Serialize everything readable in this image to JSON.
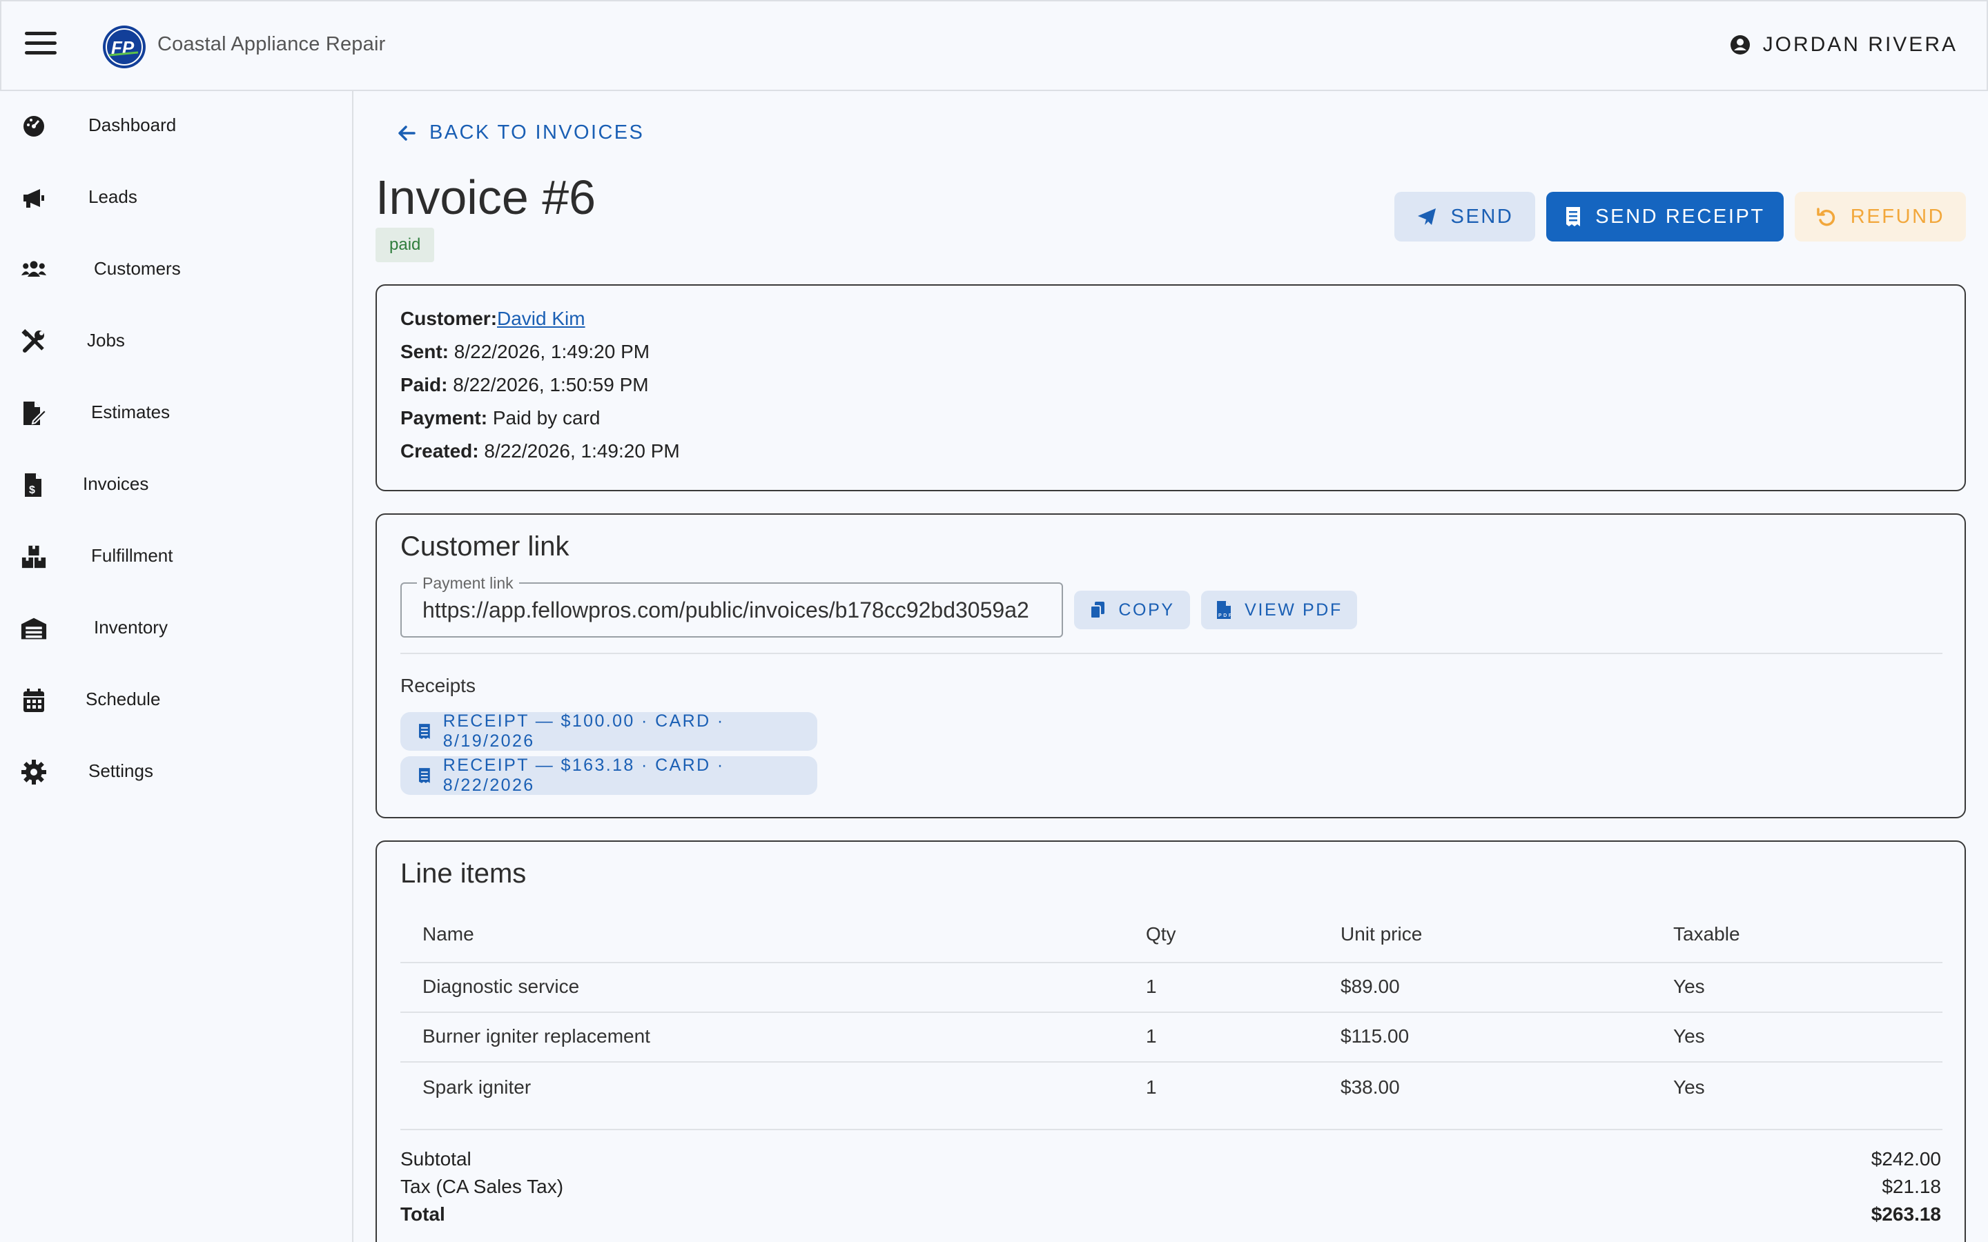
{
  "app": {
    "company_name": "Coastal Appliance Repair",
    "logo_text": "FP",
    "user_name": "JORDAN RIVERA"
  },
  "sidebar": {
    "items": [
      {
        "label": "Dashboard",
        "icon": "dashboard-icon"
      },
      {
        "label": "Leads",
        "icon": "megaphone-icon"
      },
      {
        "label": "Customers",
        "icon": "people-icon"
      },
      {
        "label": "Jobs",
        "icon": "tools-icon"
      },
      {
        "label": "Estimates",
        "icon": "file-edit-icon"
      },
      {
        "label": "Invoices",
        "icon": "invoice-dollar-icon"
      },
      {
        "label": "Fulfillment",
        "icon": "boxes-icon"
      },
      {
        "label": "Inventory",
        "icon": "warehouse-icon"
      },
      {
        "label": "Schedule",
        "icon": "calendar-icon"
      },
      {
        "label": "Settings",
        "icon": "gear-icon"
      }
    ]
  },
  "header": {
    "back_label": "BACK TO INVOICES",
    "title": "Invoice #6",
    "status": "paid",
    "buttons": {
      "send": "SEND",
      "send_receipt": "SEND RECEIPT",
      "refund": "REFUND"
    }
  },
  "details": {
    "customer_label": "Customer:",
    "customer_name": "David Kim",
    "sent_label": "Sent:",
    "sent_value": "8/22/2026, 1:49:20 PM",
    "paid_label": "Paid:",
    "paid_value": "8/22/2026, 1:50:59 PM",
    "payment_label": "Payment:",
    "payment_value": "Paid by card",
    "created_label": "Created:",
    "created_value": "8/22/2026, 1:49:20 PM"
  },
  "customer_link": {
    "heading": "Customer link",
    "field_label": "Payment link",
    "field_value": "https://app.fellowpros.com/public/invoices/b178cc92bd3059a2",
    "copy_label": "COPY",
    "pdf_label": "VIEW PDF",
    "receipts_label": "Receipts",
    "receipts": [
      "RECEIPT — $100.00 · CARD · 8/19/2026",
      "RECEIPT — $163.18 · CARD · 8/22/2026"
    ]
  },
  "line_items": {
    "heading": "Line items",
    "columns": [
      "Name",
      "Qty",
      "Unit price",
      "Taxable"
    ],
    "rows": [
      [
        "Diagnostic service",
        "1",
        "$89.00",
        "Yes"
      ],
      [
        "Burner igniter replacement",
        "1",
        "$115.00",
        "Yes"
      ],
      [
        "Spark igniter",
        "1",
        "$38.00",
        "Yes"
      ]
    ],
    "subtotal_label": "Subtotal",
    "subtotal_value": "$242.00",
    "tax_label": "Tax (CA Sales Tax)",
    "tax_value": "$21.18",
    "total_label": "Total",
    "total_value": "$263.18"
  },
  "colors": {
    "primary": "#1565c0",
    "link": "#1a5fb4",
    "status_paid_bg": "#e3ece6",
    "status_paid_text": "#2f7d3c",
    "refund_text": "#f2a73b",
    "background": "#f7f9fd"
  }
}
